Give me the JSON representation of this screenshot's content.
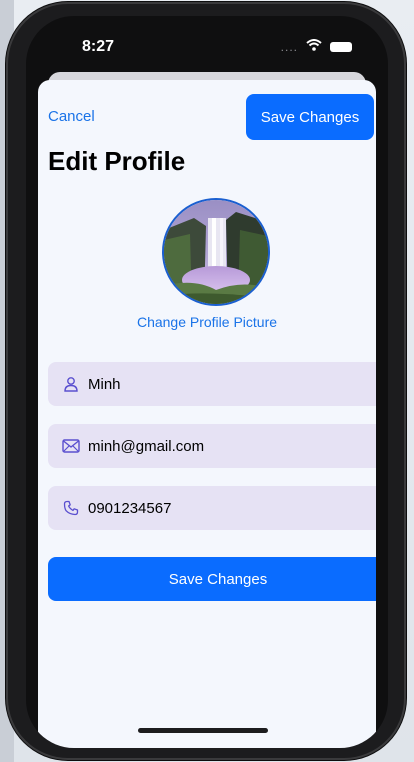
{
  "status_bar": {
    "time": "8:27",
    "signal": "....",
    "wifi_icon": "wifi-icon",
    "battery_icon": "battery-icon"
  },
  "header": {
    "cancel_label": "Cancel",
    "save_label": "Save Changes",
    "title": "Edit Profile"
  },
  "profile": {
    "avatar_icon": "waterfall-photo",
    "change_photo_label": "Change Profile Picture"
  },
  "form": {
    "name": {
      "icon": "person-icon",
      "value": "Minh"
    },
    "email": {
      "icon": "envelope-icon",
      "value": "minh@gmail.com"
    },
    "phone": {
      "icon": "phone-icon",
      "value": "0901234567"
    },
    "save_label": "Save Changes"
  },
  "colors": {
    "accent": "#0a6cff",
    "link": "#1a73e8",
    "field_bg": "#e6e2f4",
    "sheet_bg": "#f4f7fd",
    "icon": "#5a4fcf"
  }
}
